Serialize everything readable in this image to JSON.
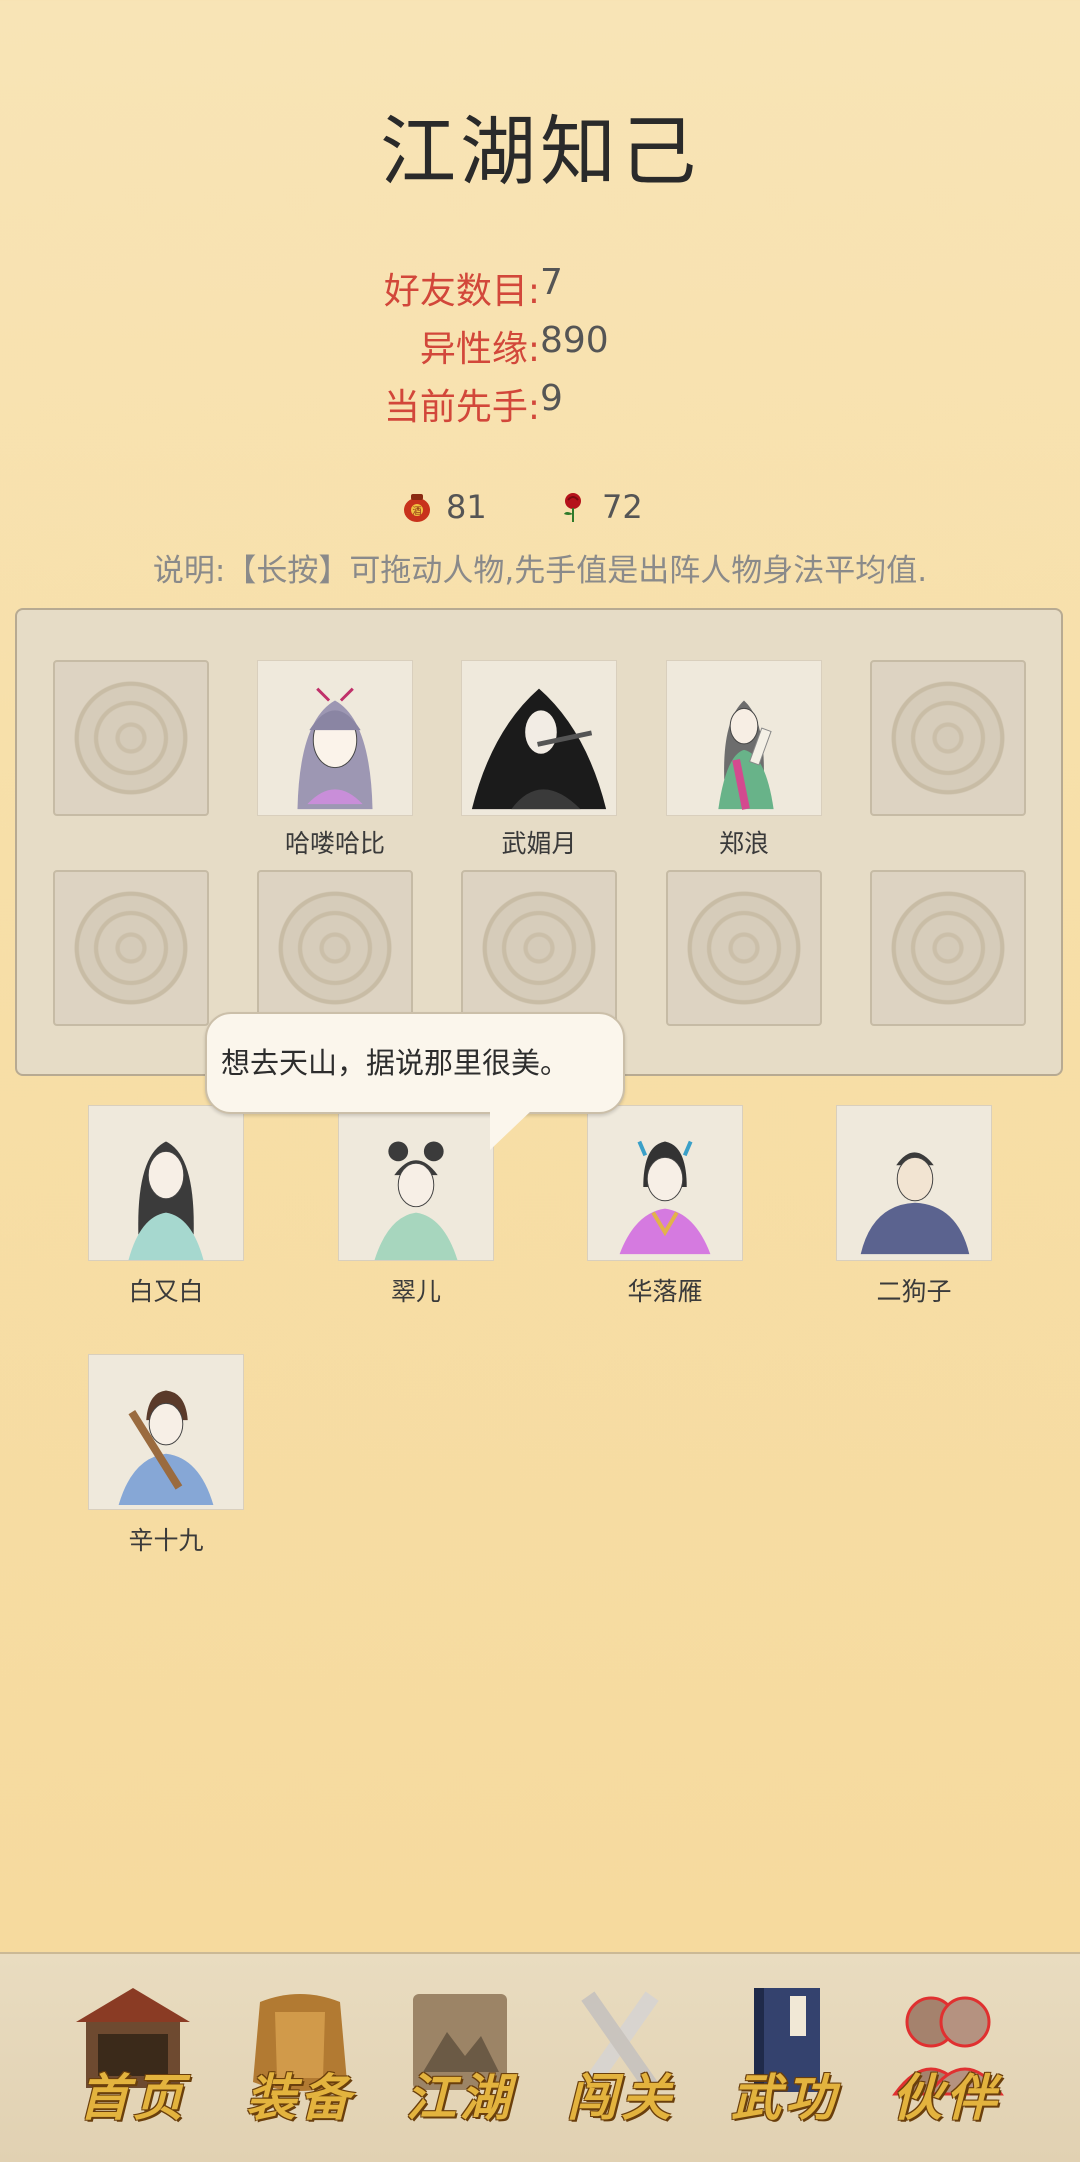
{
  "page": {
    "title": "江湖知己"
  },
  "stats": [
    {
      "label": "好友数目:",
      "value": "7"
    },
    {
      "label": "异性缘:",
      "value": "890"
    },
    {
      "label": "当前先手:",
      "value": "9"
    }
  ],
  "currencies": [
    {
      "icon": "wine-jar-icon",
      "value": "81",
      "color": "#c8321c"
    },
    {
      "icon": "rose-icon",
      "value": "72",
      "color": "#b5121b"
    }
  ],
  "note": "说明:【长按】可拖动人物,先手值是出阵人物身法平均值.",
  "formation": {
    "row1": [
      {
        "empty": true
      },
      {
        "name": "哈喽哈比"
      },
      {
        "name": "武媚月"
      },
      {
        "name": "郑浪"
      },
      {
        "empty": true
      }
    ],
    "row2": [
      {
        "empty": true
      },
      {
        "empty": true
      },
      {
        "empty": true
      },
      {
        "empty": true
      },
      {
        "empty": true
      }
    ]
  },
  "friends": [
    {
      "name": "白又白"
    },
    {
      "name": "翠儿"
    },
    {
      "name": "华落雁"
    },
    {
      "name": "二狗子"
    },
    {
      "name": "辛十九"
    }
  ],
  "speech_bubble": {
    "text": "想去天山，据说那里很美。"
  },
  "nav": [
    {
      "label": "首页",
      "icon": "house-icon",
      "active": false
    },
    {
      "label": "装备",
      "icon": "armor-icon",
      "active": false
    },
    {
      "label": "江湖",
      "icon": "scroll-map-icon",
      "active": false
    },
    {
      "label": "闯关",
      "icon": "crossed-swords-icon",
      "active": false
    },
    {
      "label": "武功",
      "icon": "book-icon",
      "active": false
    },
    {
      "label": "伙伴",
      "icon": "partners-icon",
      "active": true
    }
  ],
  "colors": {
    "stat_label": "#d2473a",
    "accent_gold": "#e3b33e",
    "active_glow": "#e03030"
  }
}
